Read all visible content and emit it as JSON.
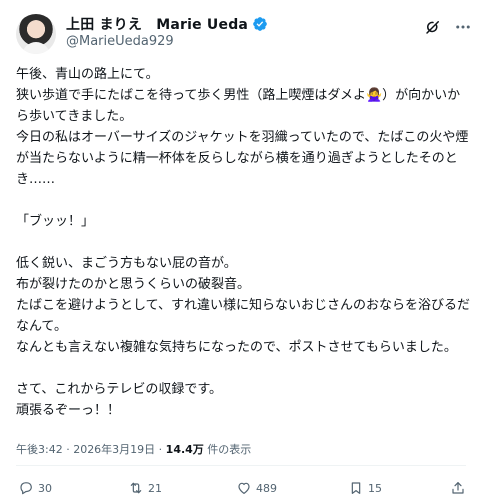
{
  "tweet": {
    "author": {
      "display_name": "上田 まりえ　Marie Ueda",
      "handle": "@MarieUeda929",
      "verified": true
    },
    "paragraphs": [
      "午後、青山の路上にて。",
      "狭い歩道で手にたばこを待って歩く男性（路上喫煙はダメよ🙅‍♀️）が向かいから歩いてきました。",
      "今日の私はオーバーサイズのジャケットを羽織っていたので、たばこの火や煙が当たらないように精一杯体を反らしながら横を通り過ぎようとしたそのとき……",
      "",
      "「ブッッ！」",
      "",
      "低く鋭い、まごう方もない屁の音が。",
      "布が裂けたのかと思うくらいの破裂音。",
      "たばこを避けようとして、すれ違い様に知らないおじさんのおならを浴びるだなんて。",
      "なんとも言えない複雑な気持ちになったので、ポストさせてもらいました。",
      "",
      "さて、これからテレビの収録です。",
      "頑張るぞーっ！！"
    ],
    "timestamp": "午後3:42 · 2026年3月19日 · ",
    "views_count": "14.4万",
    "views_label": " 件の表示"
  },
  "actions": {
    "replies": "30",
    "reposts": "21",
    "likes": "489",
    "bookmarks": "15",
    "share": ""
  },
  "colors": {
    "text": "#0f1419",
    "secondary": "#536471",
    "verified_blue": "#1d9bf0",
    "divider": "#eff3f4"
  },
  "icons": {
    "grok": "grok-icon",
    "more": "more-icon",
    "reply": "reply-icon",
    "repost": "repost-icon",
    "like": "heart-icon",
    "bookmark": "bookmark-icon",
    "share": "share-icon"
  }
}
